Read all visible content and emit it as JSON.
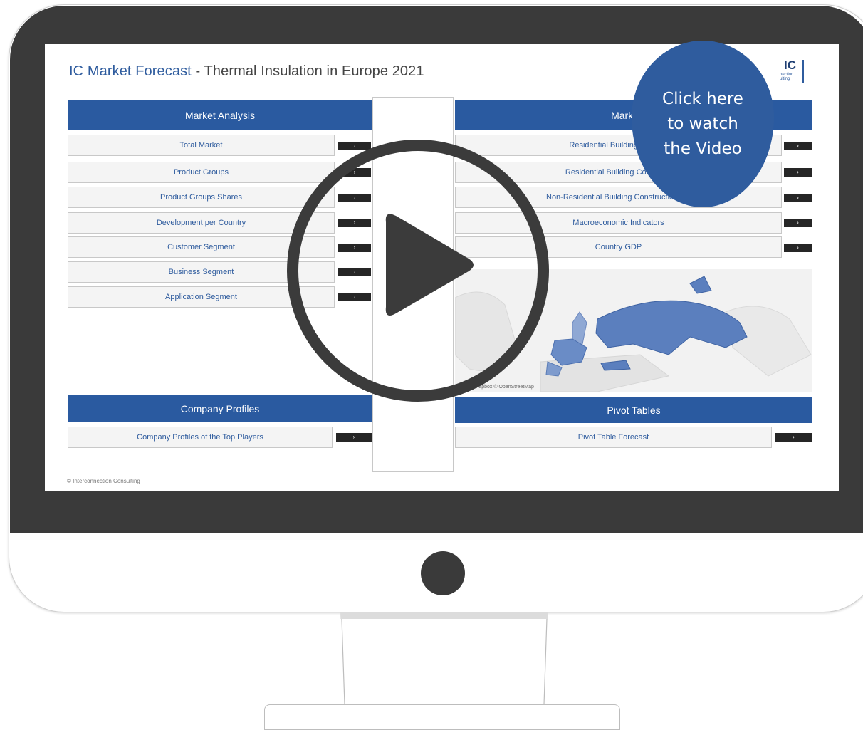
{
  "title": {
    "brand": "IC Market Forecast",
    "rest": " - Thermal Insulation in Europe 2021"
  },
  "logo": {
    "mark": "IC",
    "sub1": "nection",
    "sub2": "ulting"
  },
  "market_analysis": {
    "header": "Market Analysis",
    "items": [
      {
        "label": "Total Market",
        "arrow": "›"
      },
      {
        "label": "Product Groups",
        "arrow": "›"
      },
      {
        "label": "Product Groups Shares",
        "arrow": "›"
      },
      {
        "label": "Development per Country",
        "arrow": "›"
      },
      {
        "label": "Customer Segment",
        "arrow": "›"
      },
      {
        "label": "Business Segment",
        "arrow": "›"
      },
      {
        "label": "Application Segment",
        "arrow": "›"
      }
    ]
  },
  "market_environment": {
    "header": "Market En",
    "items": [
      {
        "label": "Residential Building Constru",
        "arrow": "›"
      },
      {
        "label": "Residential Building Constructi",
        "arrow": "›"
      },
      {
        "label": "Non-Residential Building Construction - C",
        "arrow": "›"
      },
      {
        "label": "Macroeconomic Indicators",
        "arrow": "›"
      },
      {
        "label": "Country GDP",
        "arrow": "›"
      }
    ]
  },
  "map": {
    "attribution": "2022 Mapbox © OpenStreetMap"
  },
  "company_profiles": {
    "header": "Company Profiles",
    "item": "Company Profiles of the Top Players",
    "arrow": "›"
  },
  "pivot_tables": {
    "header": "Pivot Tables",
    "item": "Pivot Table Forecast",
    "arrow": "›"
  },
  "footer": {
    "copyright": "© Interconnection Consulting"
  },
  "callout": {
    "line1": "Click here",
    "line2": "to watch",
    "line3": "the Video"
  },
  "colors": {
    "accent": "#2a5aa0",
    "bezel": "#3a3a3a",
    "map_highlight": "#5b7fbe"
  }
}
